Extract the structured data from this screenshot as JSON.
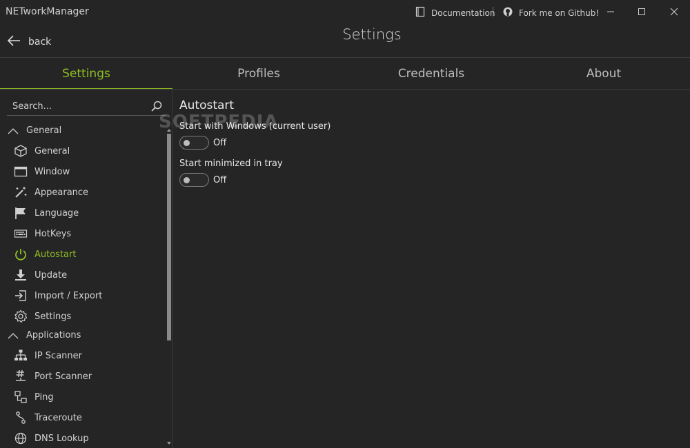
{
  "app": {
    "title": "NETworkManager",
    "documentation": "Documentation",
    "github": "Fork me on Github!"
  },
  "header": {
    "back_label": "back",
    "page_title": "Settings"
  },
  "tabs": [
    {
      "label": "Settings",
      "active": true
    },
    {
      "label": "Profiles",
      "active": false
    },
    {
      "label": "Credentials",
      "active": false
    },
    {
      "label": "About",
      "active": false
    }
  ],
  "sidebar": {
    "search_placeholder": "Search...",
    "groups": [
      {
        "label": "General",
        "expanded": true,
        "items": [
          {
            "label": "General",
            "icon": "cube-icon"
          },
          {
            "label": "Window",
            "icon": "window-icon"
          },
          {
            "label": "Appearance",
            "icon": "magic-wand-icon"
          },
          {
            "label": "Language",
            "icon": "flag-icon"
          },
          {
            "label": "HotKeys",
            "icon": "keyboard-icon"
          },
          {
            "label": "Autostart",
            "icon": "power-icon",
            "active": true
          },
          {
            "label": "Update",
            "icon": "download-icon"
          },
          {
            "label": "Import / Export",
            "icon": "import-icon"
          },
          {
            "label": "Settings",
            "icon": "gear-icon"
          }
        ]
      },
      {
        "label": "Applications",
        "expanded": true,
        "items": [
          {
            "label": "IP Scanner",
            "icon": "network-tree-icon"
          },
          {
            "label": "Port Scanner",
            "icon": "hash-plug-icon"
          },
          {
            "label": "Ping",
            "icon": "ping-icon"
          },
          {
            "label": "Traceroute",
            "icon": "route-icon"
          },
          {
            "label": "DNS Lookup",
            "icon": "globe-icon"
          }
        ]
      }
    ]
  },
  "content": {
    "section_title": "Autostart",
    "options": [
      {
        "label": "Start with Windows (current user)",
        "state": "Off",
        "on": false
      },
      {
        "label": "Start minimized in tray",
        "state": "Off",
        "on": false
      }
    ]
  },
  "watermark": "SOFTPEDIA",
  "colors": {
    "accent": "#8fbf22",
    "background": "#252525",
    "text": "#e6e6e6",
    "divider": "#3b3b3b"
  }
}
